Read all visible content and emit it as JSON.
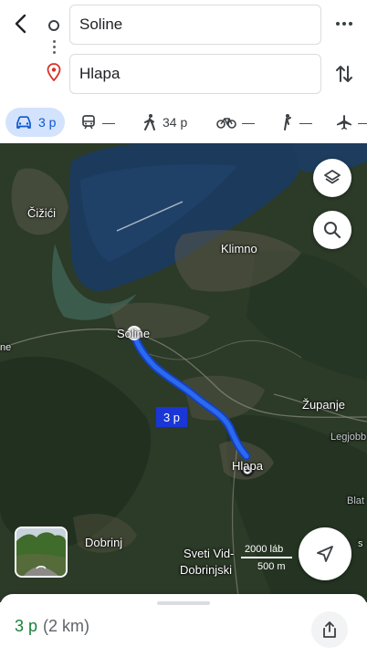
{
  "directions": {
    "origin": "Soline",
    "destination": "Hlapa"
  },
  "modes": [
    {
      "name": "drive",
      "icon": "car-icon",
      "label": "3 p",
      "active": true
    },
    {
      "name": "transit",
      "icon": "train-icon",
      "label": "—"
    },
    {
      "name": "walk",
      "icon": "walking-icon",
      "label": "34 p"
    },
    {
      "name": "bike",
      "icon": "bicycle-icon",
      "label": "—"
    },
    {
      "name": "ride",
      "icon": "ride-hail-icon",
      "label": "—"
    },
    {
      "name": "flight",
      "icon": "airplane-icon",
      "label": "—"
    }
  ],
  "map": {
    "places": {
      "cizici": "Čižići",
      "klimno": "Klimno",
      "soline": "Soline",
      "zupanje": "Županje",
      "legjobb": "Legjobb",
      "hlapa": "Hlapa",
      "dobrinj": "Dobrinj",
      "sveti": "Sveti Vid-",
      "dobrinjski": "Dobrinjski",
      "blat": "Blat",
      "edge_left": "ne",
      "edge_right": "s"
    },
    "route_badge": "3 p",
    "scale": {
      "feet": "2000 láb",
      "meters": "500 m"
    }
  },
  "summary": {
    "duration": "3 p",
    "distance": "(2 km)"
  },
  "colors": {
    "route": "#1a73e8",
    "active_mode_bg": "#d3e3fd",
    "duration": "#188038",
    "destination_pin": "#d93025"
  }
}
